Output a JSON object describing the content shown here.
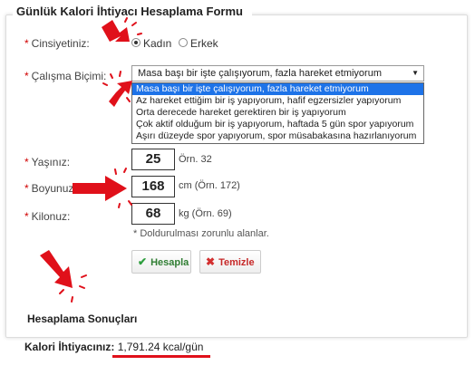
{
  "form": {
    "title": "Günlük Kalori İhtiyacı Hesaplama Formu",
    "gender": {
      "label": "Cinsiyetiniz:",
      "options": [
        "Kadın",
        "Erkek"
      ],
      "selected": "Kadın"
    },
    "work": {
      "label": "Çalışma Biçimi:",
      "selected": "Masa başı bir işte çalışıyorum, fazla hareket etmiyorum",
      "options": [
        "Masa başı bir işte çalışıyorum, fazla hareket etmiyorum",
        "Az hareket ettiğim bir iş yapıyorum, hafif egzersizler yapıyorum",
        "Orta derecede hareket gerektiren bir iş yapıyorum",
        "Çok aktif olduğum bir iş yapıyorum, haftada 5 gün spor yapıyorum",
        "Aşırı düzeyde spor yapıyorum, spor müsabakasına hazırlanıyorum"
      ]
    },
    "age": {
      "label": "Yaşınız:",
      "value": "25",
      "hint": "Örn. 32"
    },
    "height": {
      "label": "Boyunuz:",
      "value": "168",
      "hint": "cm (Örn. 172)"
    },
    "weight": {
      "label": "Kilonuz:",
      "value": "68",
      "hint": "kg (Örn. 69)"
    },
    "required_note": "* Doldurulması zorunlu alanlar.",
    "calculate_label": "Hesapla",
    "clear_label": "Temizle",
    "required_star": "*"
  },
  "results": {
    "title": "Hesaplama Sonuçları",
    "label": "Kalori İhtiyacınız:",
    "value": "1,791.24 kcal/gün"
  },
  "colors": {
    "annotation_red": "#e0101a",
    "selection_blue": "#1e73e8",
    "button_green": "#2e9e3e",
    "button_red": "#d32f2f"
  }
}
